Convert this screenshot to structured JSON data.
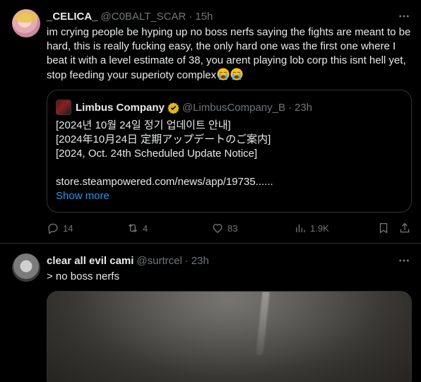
{
  "tweets": [
    {
      "display_name": "_CELICA_",
      "handle": "@C0BALT_SCAR",
      "separator": "·",
      "time": "15h",
      "text": "im crying people be hyping up no boss nerfs saying the fights are meant to be hard, this is really fucking easy, the only hard one was the first one where I beat it with a level estimate of 38, you arent playing lob corp this isnt hell yet, stop feeding your superioty complex",
      "emoji": [
        "loudly-crying-face-emoji",
        "loudly-crying-face-emoji"
      ],
      "quote": {
        "display_name": "Limbus Company",
        "handle": "@LimbusCompany_B",
        "separator": "·",
        "time": "23h",
        "lines": [
          "[2024년 10월 24일 정기 업데이트 안내]",
          "[2024年10月24日 定期アップデートのご案内]",
          "[2024, Oct. 24th Scheduled Update Notice]",
          "",
          "store.steampowered.com/news/app/19735......"
        ],
        "show_more": "Show more",
        "verified_color": "#e2b719"
      },
      "stats": {
        "replies": "14",
        "reposts": "4",
        "likes": "83",
        "views": "1.9K"
      }
    },
    {
      "display_name": "clear all evil cami",
      "handle": "@surtrcel",
      "separator": "·",
      "time": "23h",
      "text": "> no boss nerfs"
    }
  ],
  "colors": {
    "background": "#000000",
    "text": "#e7e9ea",
    "muted": "#71767b",
    "border": "#2f3336",
    "link": "#1d9bf0"
  }
}
